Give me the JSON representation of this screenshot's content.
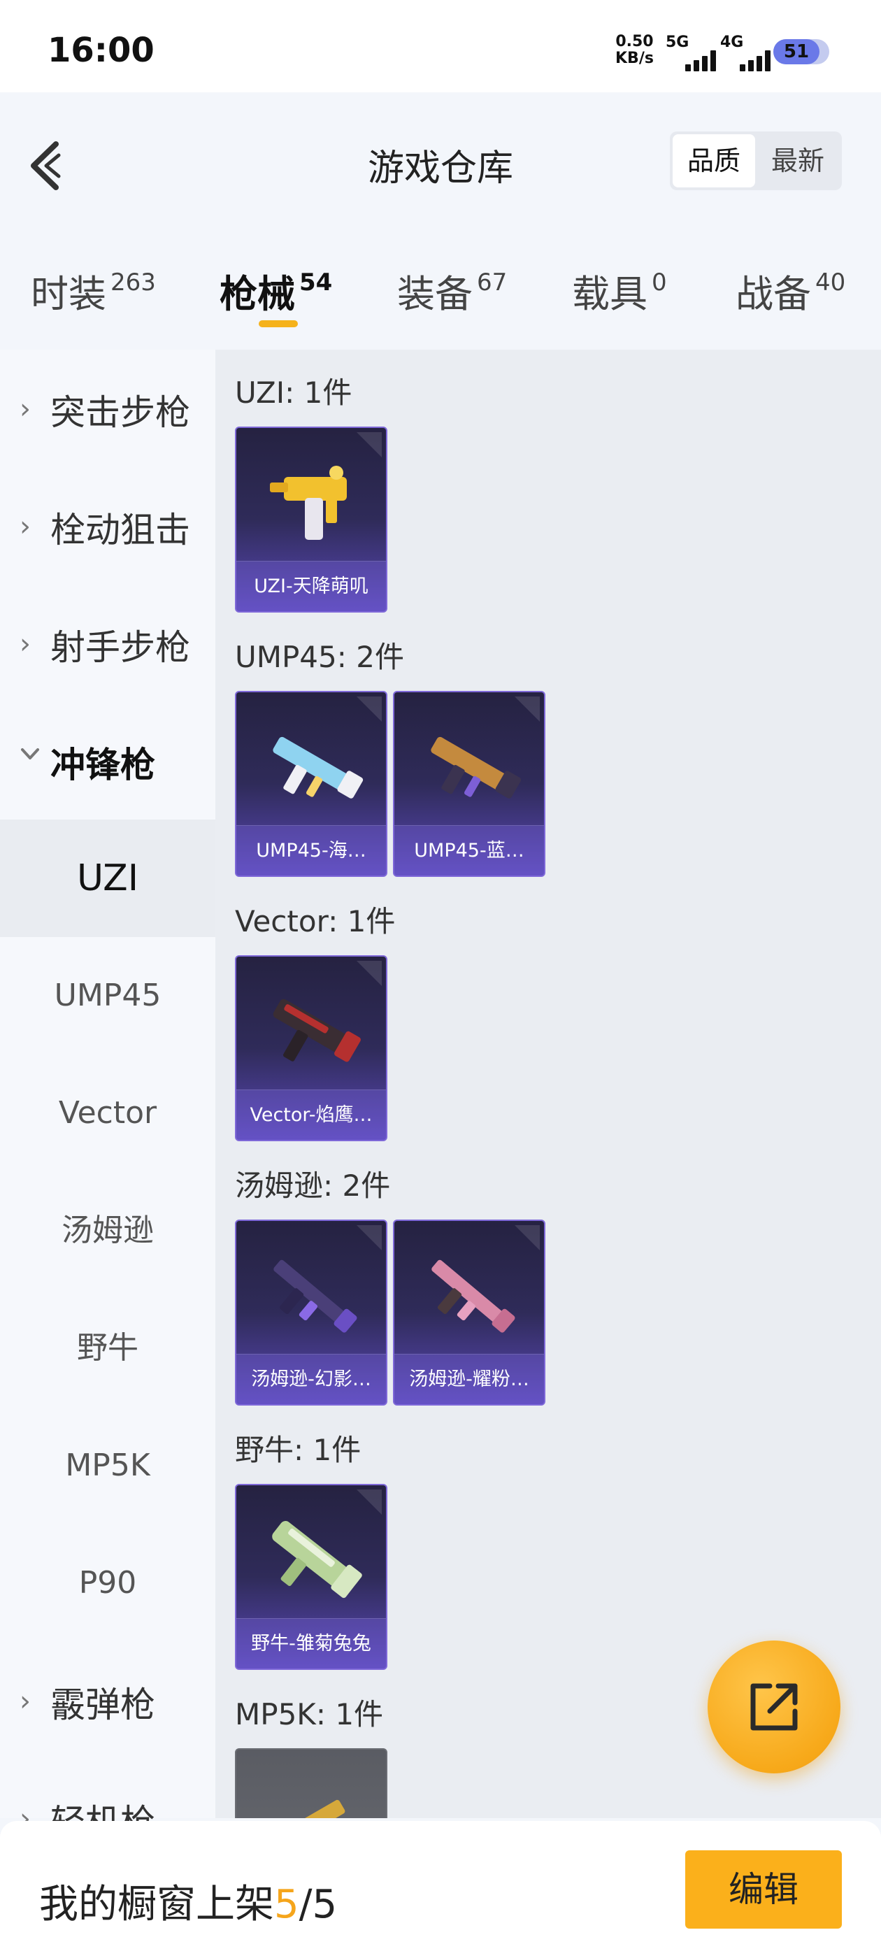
{
  "status_bar": {
    "time": "16:00",
    "net_speed_value": "0.50",
    "net_speed_unit": "KB/s",
    "signal_1_label": "5G",
    "signal_2_label": "4G",
    "battery": "51"
  },
  "header": {
    "title": "游戏仓库",
    "sort_options": [
      "品质",
      "最新"
    ]
  },
  "tabs": [
    {
      "label": "时装",
      "count": "263"
    },
    {
      "label": "枪械",
      "count": "54"
    },
    {
      "label": "装备",
      "count": "67"
    },
    {
      "label": "载具",
      "count": "0"
    },
    {
      "label": "战备",
      "count": "40"
    }
  ],
  "sidebar": {
    "categories": [
      {
        "label": "突击步枪",
        "expanded": false
      },
      {
        "label": "栓动狙击",
        "expanded": false
      },
      {
        "label": "射手步枪",
        "expanded": false
      },
      {
        "label": "冲锋枪",
        "expanded": true
      },
      {
        "label": "霰弹枪",
        "expanded": false
      },
      {
        "label": "轻机枪",
        "expanded": false
      }
    ],
    "sub_items": [
      "UZI",
      "UMP45",
      "Vector",
      "汤姆逊",
      "野牛",
      "MP5K",
      "P90"
    ],
    "selected_sub": "UZI"
  },
  "groups": [
    {
      "title": "UZI: 1件",
      "items": [
        "UZI-天降萌叽"
      ]
    },
    {
      "title": "UMP45: 2件",
      "items": [
        "UMP45-海…",
        "UMP45-蓝…"
      ]
    },
    {
      "title": "Vector: 1件",
      "items": [
        "Vector-焰鹰…"
      ]
    },
    {
      "title": "汤姆逊: 2件",
      "items": [
        "汤姆逊-幻影…",
        "汤姆逊-耀粉…"
      ]
    },
    {
      "title": "野牛: 1件",
      "items": [
        "野牛-雏菊兔兔"
      ]
    },
    {
      "title": "MP5K: 1件",
      "items": [
        ""
      ]
    }
  ],
  "bottom_bar": {
    "shelf_label": "我的橱窗上架",
    "shelf_current": "5",
    "shelf_separator": "/",
    "shelf_total": "5",
    "edit_label": "编辑"
  },
  "colors": {
    "accent": "#fbb01b",
    "card_border": "#7e68d8",
    "card_bg_top": "#252241",
    "card_bg_bottom": "#5a48b8"
  }
}
